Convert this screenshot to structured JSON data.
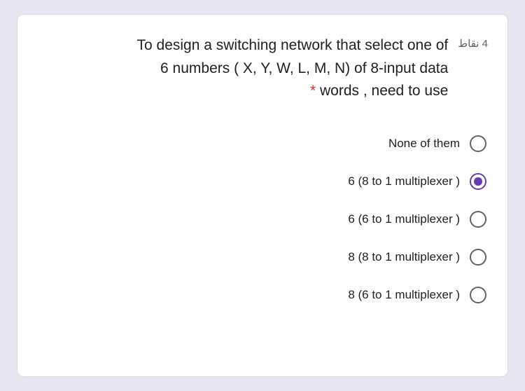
{
  "question": {
    "points_label": "4 نقاط",
    "text_line1": "To design a switching network that select one of",
    "text_line2": "6 numbers ( X, Y, W, L, M, N) of 8-input data",
    "text_line3_before_ast": " words , need to use",
    "asterisk": "*"
  },
  "options": [
    {
      "label": "None of them",
      "selected": false
    },
    {
      "label": "6 (8 to 1 multiplexer )",
      "selected": true
    },
    {
      "label": "6 (6 to 1 multiplexer )",
      "selected": false
    },
    {
      "label": "8 (8 to 1 multiplexer )",
      "selected": false
    },
    {
      "label": "8 (6 to 1 multiplexer )",
      "selected": false
    }
  ]
}
